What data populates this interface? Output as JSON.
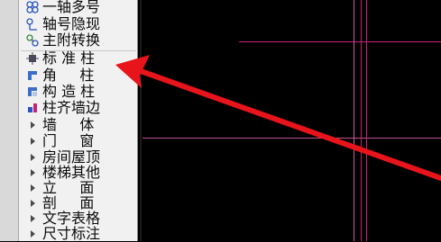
{
  "menu": {
    "items": [
      {
        "label": "一轴多号",
        "icon": "multi-axis-icon"
      },
      {
        "label": "轴号隐现",
        "icon": "axis-toggle-icon"
      },
      {
        "label": "主附转换",
        "icon": "main-sub-convert-icon"
      },
      {
        "label": "标 准 柱",
        "icon": "standard-column-icon"
      },
      {
        "label": "角     柱",
        "icon": "corner-column-icon"
      },
      {
        "label": "构 造 柱",
        "icon": "structural-column-icon"
      },
      {
        "label": "柱齐墙边",
        "icon": "align-column-wall-icon"
      },
      {
        "label": "墙     体",
        "icon": "submenu-arrow-icon"
      },
      {
        "label": "门     窗",
        "icon": "submenu-arrow-icon"
      },
      {
        "label": "房间屋顶",
        "icon": "submenu-arrow-icon"
      },
      {
        "label": "楼梯其他",
        "icon": "submenu-arrow-icon"
      },
      {
        "label": "立     面",
        "icon": "submenu-arrow-icon"
      },
      {
        "label": "剖     面",
        "icon": "submenu-arrow-icon"
      },
      {
        "label": "文字表格",
        "icon": "submenu-arrow-icon"
      },
      {
        "label": "尺寸标注",
        "icon": "submenu-arrow-icon"
      }
    ]
  },
  "colors": {
    "canvas_bg": "#000000",
    "menu_bg": "#f1f1f1",
    "axis_line": "#c8217a",
    "axis_line_light": "#d25aa2",
    "arrow": "#e8141b"
  }
}
